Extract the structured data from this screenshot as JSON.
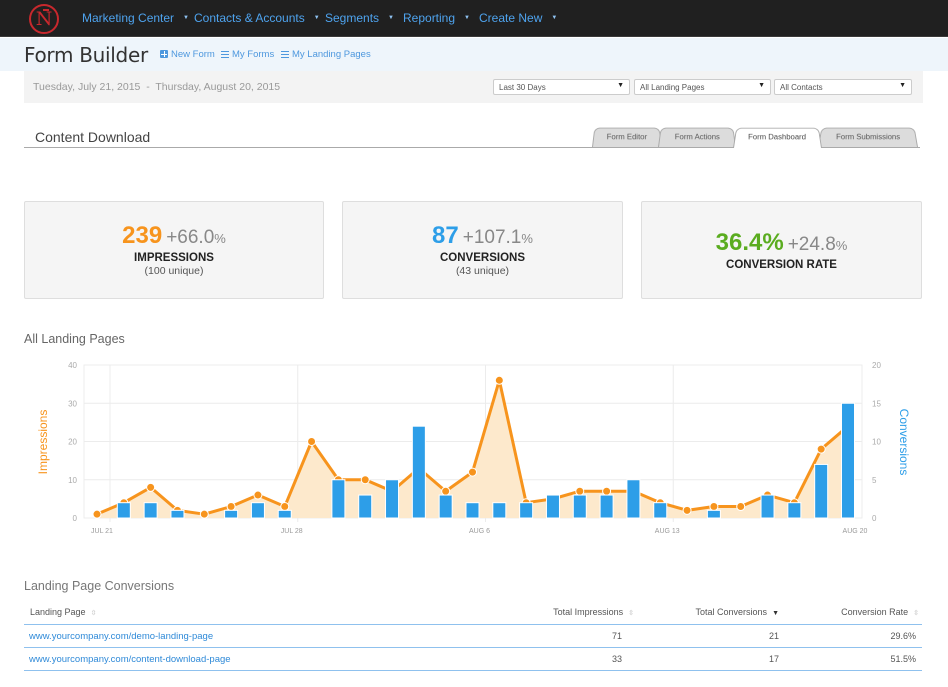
{
  "nav": {
    "items": [
      {
        "label": "Marketing Center"
      },
      {
        "label": "Contacts & Accounts"
      },
      {
        "label": "Segments"
      },
      {
        "label": "Reporting"
      },
      {
        "label": "Create New"
      }
    ],
    "logo_letter": "N"
  },
  "subheader": {
    "title": "Form Builder",
    "links": [
      {
        "label": "New Form",
        "icon": "plus-square-icon"
      },
      {
        "label": "My Forms",
        "icon": "list-icon"
      },
      {
        "label": "My Landing Pages",
        "icon": "list-icon"
      }
    ]
  },
  "filters": {
    "date_range": "Tuesday, July 21, 2015  -  Thursday, August 20, 2015",
    "period": "Last 30 Days",
    "landing_pages": "All Landing Pages",
    "contacts": "All Contacts"
  },
  "form": {
    "name": "Content Download",
    "tabs": [
      {
        "label": "Form Editor",
        "active": false
      },
      {
        "label": "Form Actions",
        "active": false
      },
      {
        "label": "Form Dashboard",
        "active": true
      },
      {
        "label": "Form Submissions",
        "active": false
      }
    ]
  },
  "stats": {
    "impressions": {
      "value": "239",
      "delta": "+66.0",
      "pct": "%",
      "label": "IMPRESSIONS",
      "sub": "(100 unique)",
      "color": "#f7941d"
    },
    "conversions": {
      "value": "87",
      "delta": "+107.1",
      "pct": "%",
      "label": "CONVERSIONS",
      "sub": "(43 unique)",
      "color": "#2d9ee8"
    },
    "rate": {
      "value": "36.4%",
      "delta": "+24.8",
      "pct": "%",
      "label": "CONVERSION RATE",
      "color": "#5aac1f"
    }
  },
  "chart_title": "All Landing Pages",
  "chart_data": {
    "type": "bar+area",
    "title": "All Landing Pages",
    "x_tick_labels": [
      "JUL 21",
      "JUL 28",
      "AUG 6",
      "AUG 13",
      "AUG 20"
    ],
    "x_tick_index": [
      0,
      7,
      14,
      21,
      28
    ],
    "y_left": {
      "label": "Impressions",
      "ticks": [
        0,
        10,
        20,
        30,
        40
      ],
      "range": [
        0,
        40
      ],
      "color": "#f7941d"
    },
    "y_right": {
      "label": "Conversions",
      "ticks": [
        0,
        5,
        10,
        15,
        20
      ],
      "range": [
        0,
        20
      ],
      "color": "#2d9ee8"
    },
    "series": [
      {
        "name": "Impressions",
        "kind": "area-line",
        "axis": "left",
        "values": [
          1,
          4,
          8,
          2,
          1,
          3,
          6,
          3,
          20,
          10,
          10,
          7,
          13,
          7,
          12,
          36,
          4,
          5,
          7,
          7,
          7,
          4,
          2,
          3,
          3,
          6,
          4,
          18,
          24
        ]
      },
      {
        "name": "Conversions",
        "kind": "bar",
        "axis": "right",
        "values": [
          0,
          2,
          2,
          1,
          0,
          1,
          2,
          1,
          0,
          5,
          3,
          5,
          12,
          3,
          2,
          2,
          2,
          3,
          3,
          3,
          5,
          2,
          0,
          1,
          0,
          3,
          2,
          7,
          15
        ]
      }
    ],
    "grid": true,
    "legend": "none"
  },
  "table": {
    "title": "Landing Page Conversions",
    "columns": [
      {
        "label": "Landing Page",
        "sort": "none"
      },
      {
        "label": "Total Impressions",
        "sort": "none"
      },
      {
        "label": "Total Conversions",
        "sort": "desc"
      },
      {
        "label": "Conversion Rate",
        "sort": "none"
      }
    ],
    "rows": [
      {
        "page": "www.yourcompany.com/demo-landing-page",
        "impressions": "71",
        "conversions": "21",
        "rate": "29.6%"
      },
      {
        "page": "www.yourcompany.com/content-download-page",
        "impressions": "33",
        "conversions": "17",
        "rate": "51.5%"
      }
    ]
  }
}
